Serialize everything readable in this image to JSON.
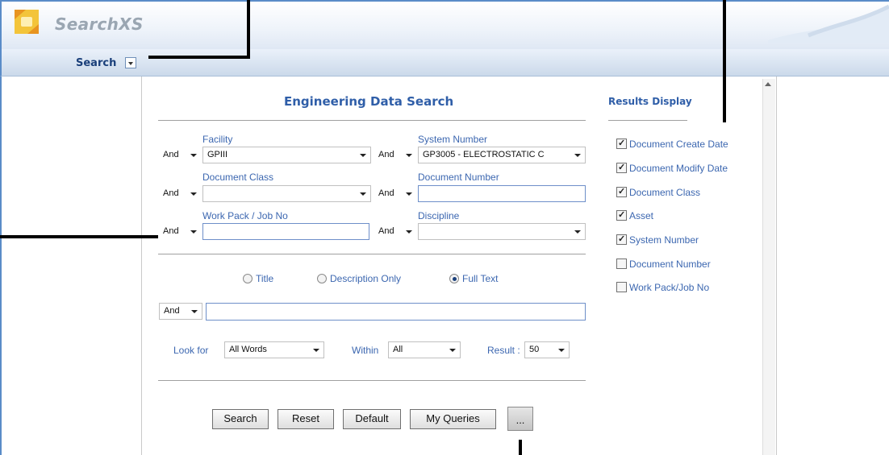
{
  "header": {
    "app_title": "SearchXS"
  },
  "menu": {
    "search_label": "Search"
  },
  "form": {
    "title": "Engineering Data Search",
    "operator": "And",
    "fields": {
      "facility": {
        "label": "Facility",
        "value": "GPIII"
      },
      "system_number": {
        "label": "System Number",
        "value": "GP3005 - ELECTROSTATIC C"
      },
      "document_class": {
        "label": "Document Class",
        "value": ""
      },
      "document_number": {
        "label": "Document Number",
        "value": ""
      },
      "work_pack": {
        "label": "Work Pack / Job No",
        "value": ""
      },
      "discipline": {
        "label": "Discipline",
        "value": ""
      }
    },
    "search_mode": {
      "options": [
        "Title",
        "Description Only",
        "Full Text"
      ],
      "selected": "Full Text"
    },
    "text_query": "",
    "look_for": {
      "label": "Look for",
      "value": "All Words"
    },
    "within": {
      "label": "Within",
      "value": "All"
    },
    "result": {
      "label": "Result :",
      "value": "50"
    },
    "buttons": {
      "search": "Search",
      "reset": "Reset",
      "default": "Default",
      "my_queries": "My Queries",
      "more": "..."
    }
  },
  "results_display": {
    "title": "Results Display",
    "items": [
      {
        "label": "Document Create Date",
        "checked": true
      },
      {
        "label": "Document Modify Date",
        "checked": true
      },
      {
        "label": "Document Class",
        "checked": true
      },
      {
        "label": "Asset",
        "checked": true
      },
      {
        "label": "System Number",
        "checked": true
      },
      {
        "label": "Document Number",
        "checked": false
      },
      {
        "label": "Work Pack/Job No",
        "checked": false
      }
    ]
  }
}
